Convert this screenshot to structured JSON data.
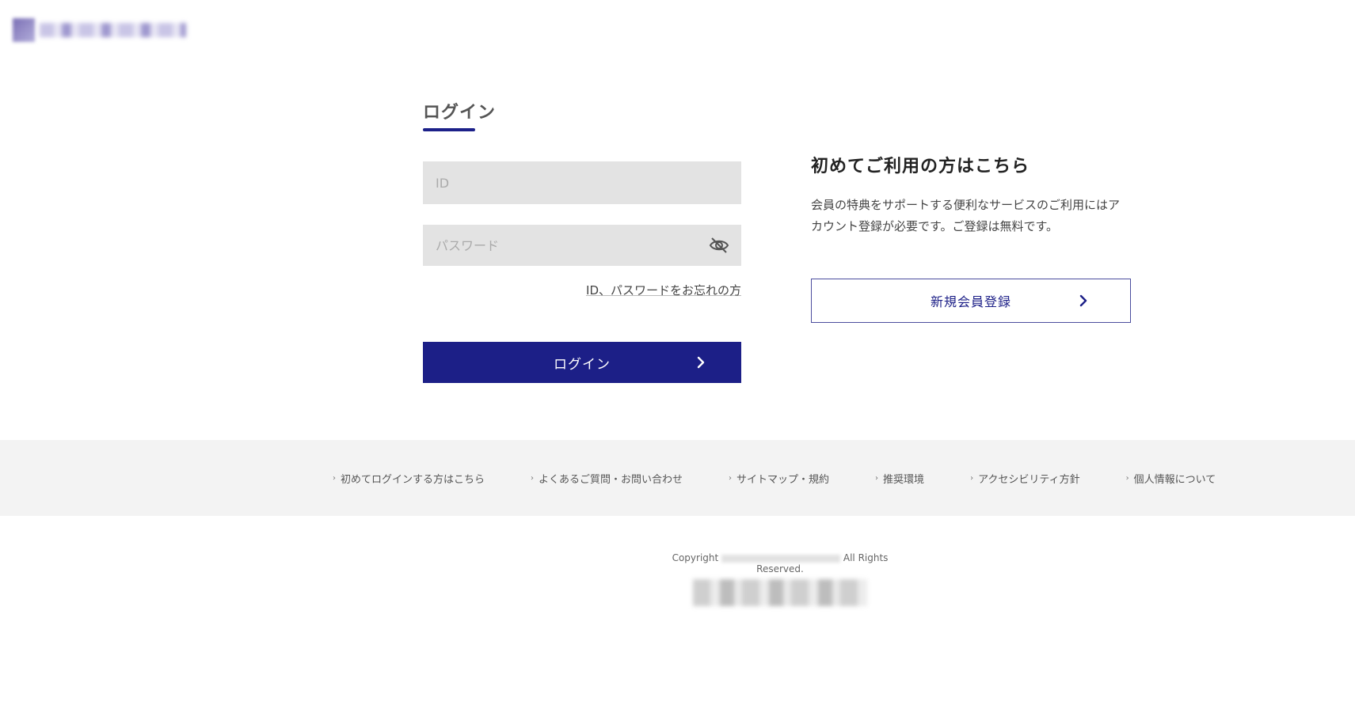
{
  "header": {
    "logo_alt": ""
  },
  "login": {
    "tab_title": "ログイン",
    "id_placeholder": "ID",
    "password_placeholder": "パスワード",
    "password_toggle_icon": "eye-slash-icon",
    "forgot_link": "ID、パスワードをお忘れの方",
    "submit_label": "ログイン",
    "submit_icon": "chevron-right-icon"
  },
  "register": {
    "title": "初めてご利用の方はこちら",
    "description": "会員の特典をサポートする便利なサービスのご利用にはアカウント登録が必要です。ご登録は無料です。",
    "button_label": "新規会員登録",
    "button_icon": "chevron-right-icon"
  },
  "footer": {
    "links": [
      {
        "label": "初めてログインする方はこちら"
      },
      {
        "label": "よくあるご質問・お問い合わせ"
      },
      {
        "label": "サイトマップ・規約"
      },
      {
        "label": "推奨環境"
      },
      {
        "label": "アクセシビリティ方針"
      },
      {
        "label": "個人情報について"
      }
    ],
    "link_icon": "arrow-right-icon",
    "copyright_prefix": "Copyright",
    "copyright_suffix": "All Rights Reserved."
  },
  "colors": {
    "primary": "#1c1f87",
    "field_bg": "#e3e3e3",
    "footer_bg": "#f3f3f3"
  }
}
